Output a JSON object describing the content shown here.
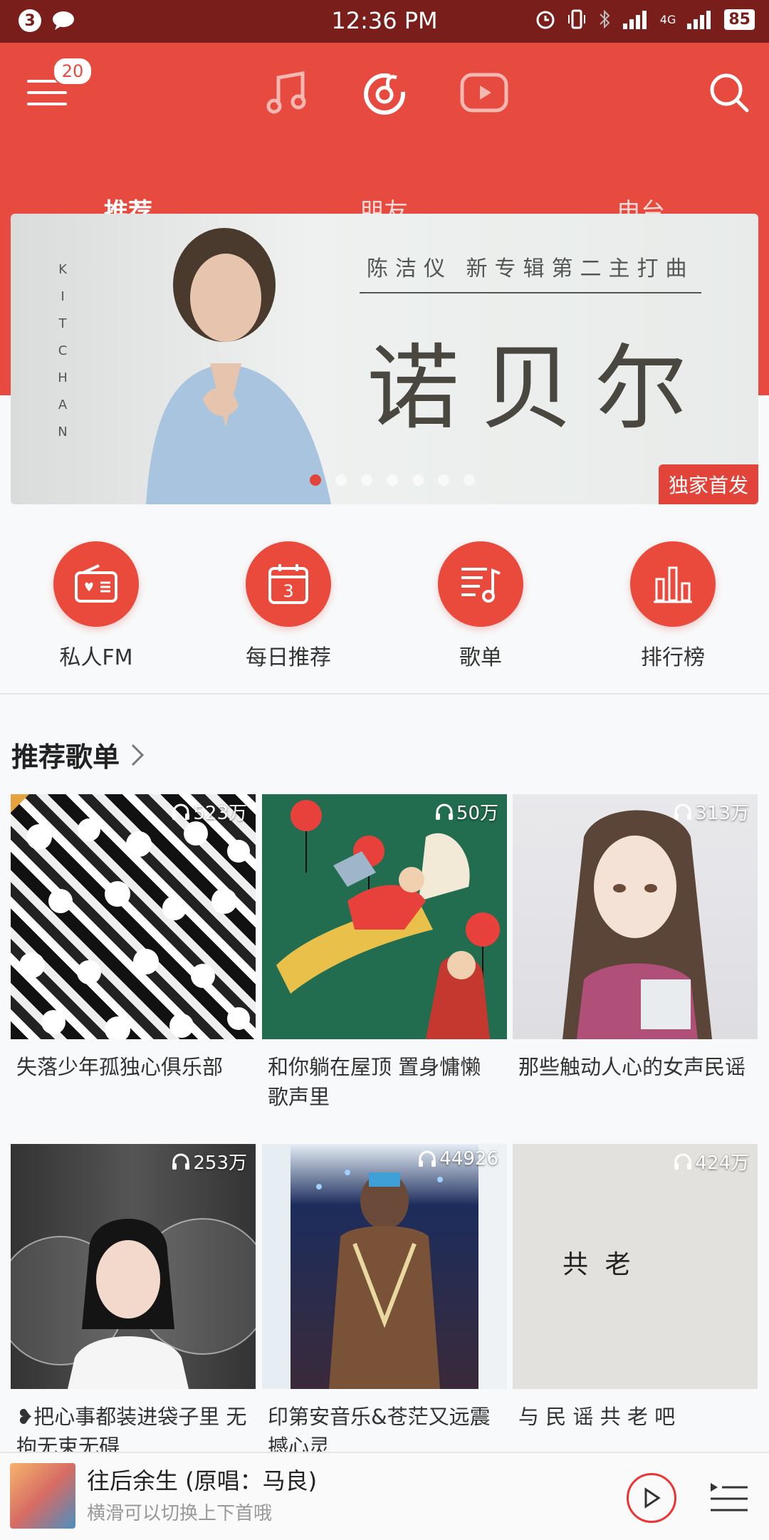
{
  "status_bar": {
    "notif_count": "3",
    "time": "12:36 PM",
    "battery": "85",
    "network": "4G"
  },
  "header": {
    "menu_badge": "20",
    "tabs": [
      {
        "label": "推荐"
      },
      {
        "label": "朋友"
      },
      {
        "label": "电台"
      }
    ]
  },
  "banner": {
    "side_text": "KIT CHAN",
    "subtitle": "陈洁仪  新专辑第二主打曲",
    "title": "诺贝尔",
    "tag": "独家首发",
    "page_count": 7,
    "active_page": 1
  },
  "features": [
    {
      "label": "私人FM",
      "icon": "radio-icon"
    },
    {
      "label": "每日推荐",
      "icon": "calendar-icon",
      "day": "3"
    },
    {
      "label": "歌单",
      "icon": "playlist-icon"
    },
    {
      "label": "排行榜",
      "icon": "chart-icon"
    }
  ],
  "section": {
    "title": "推荐歌单"
  },
  "playlists": [
    {
      "count": "523万",
      "title": "失落少年孤独心俱乐部"
    },
    {
      "count": "50万",
      "title": "和你躺在屋顶 置身慵懒歌声里"
    },
    {
      "count": "313万",
      "title": "那些触动人心的女声民谣"
    },
    {
      "count": "253万",
      "title": "❥把心事都装进袋子里 无拘无束无碍"
    },
    {
      "count": "44926",
      "title": "印第安音乐&苍茫又远震撼心灵"
    },
    {
      "count": "424万",
      "title": "与 民 谣 共 老 吧"
    }
  ],
  "cover_text": {
    "c6": "共  老"
  },
  "player": {
    "title": "往后余生 (原唱：马良)",
    "subtitle": "横滑可以切换上下首哦"
  },
  "colors": {
    "primary": "#e74a3e",
    "statusbar": "#7a1e1b"
  }
}
